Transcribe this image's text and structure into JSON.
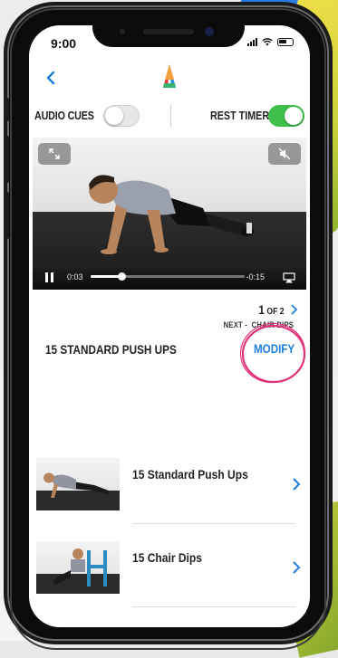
{
  "status_bar": {
    "time": "9:00"
  },
  "controls": {
    "audio_cues_label": "AUDIO CUES",
    "audio_cues_on": false,
    "rest_timer_label": "REST TIMER",
    "rest_timer_on": true
  },
  "video": {
    "elapsed": "0:03",
    "remaining": "-0:15",
    "progress_fraction": 0.2
  },
  "exercise": {
    "index": "1",
    "of_total": "OF 2",
    "next_prefix": "NEXT -",
    "next_name": "CHAIR DIPS",
    "title": "15 STANDARD PUSH UPS",
    "modify_label": "MODIFY"
  },
  "list": [
    {
      "name": "15 Standard Push Ups"
    },
    {
      "name": "15 Chair Dips"
    }
  ],
  "colors": {
    "accent_blue": "#1c7ee0",
    "toggle_green": "#3ec04a",
    "annotation_pink": "#e0337a"
  }
}
